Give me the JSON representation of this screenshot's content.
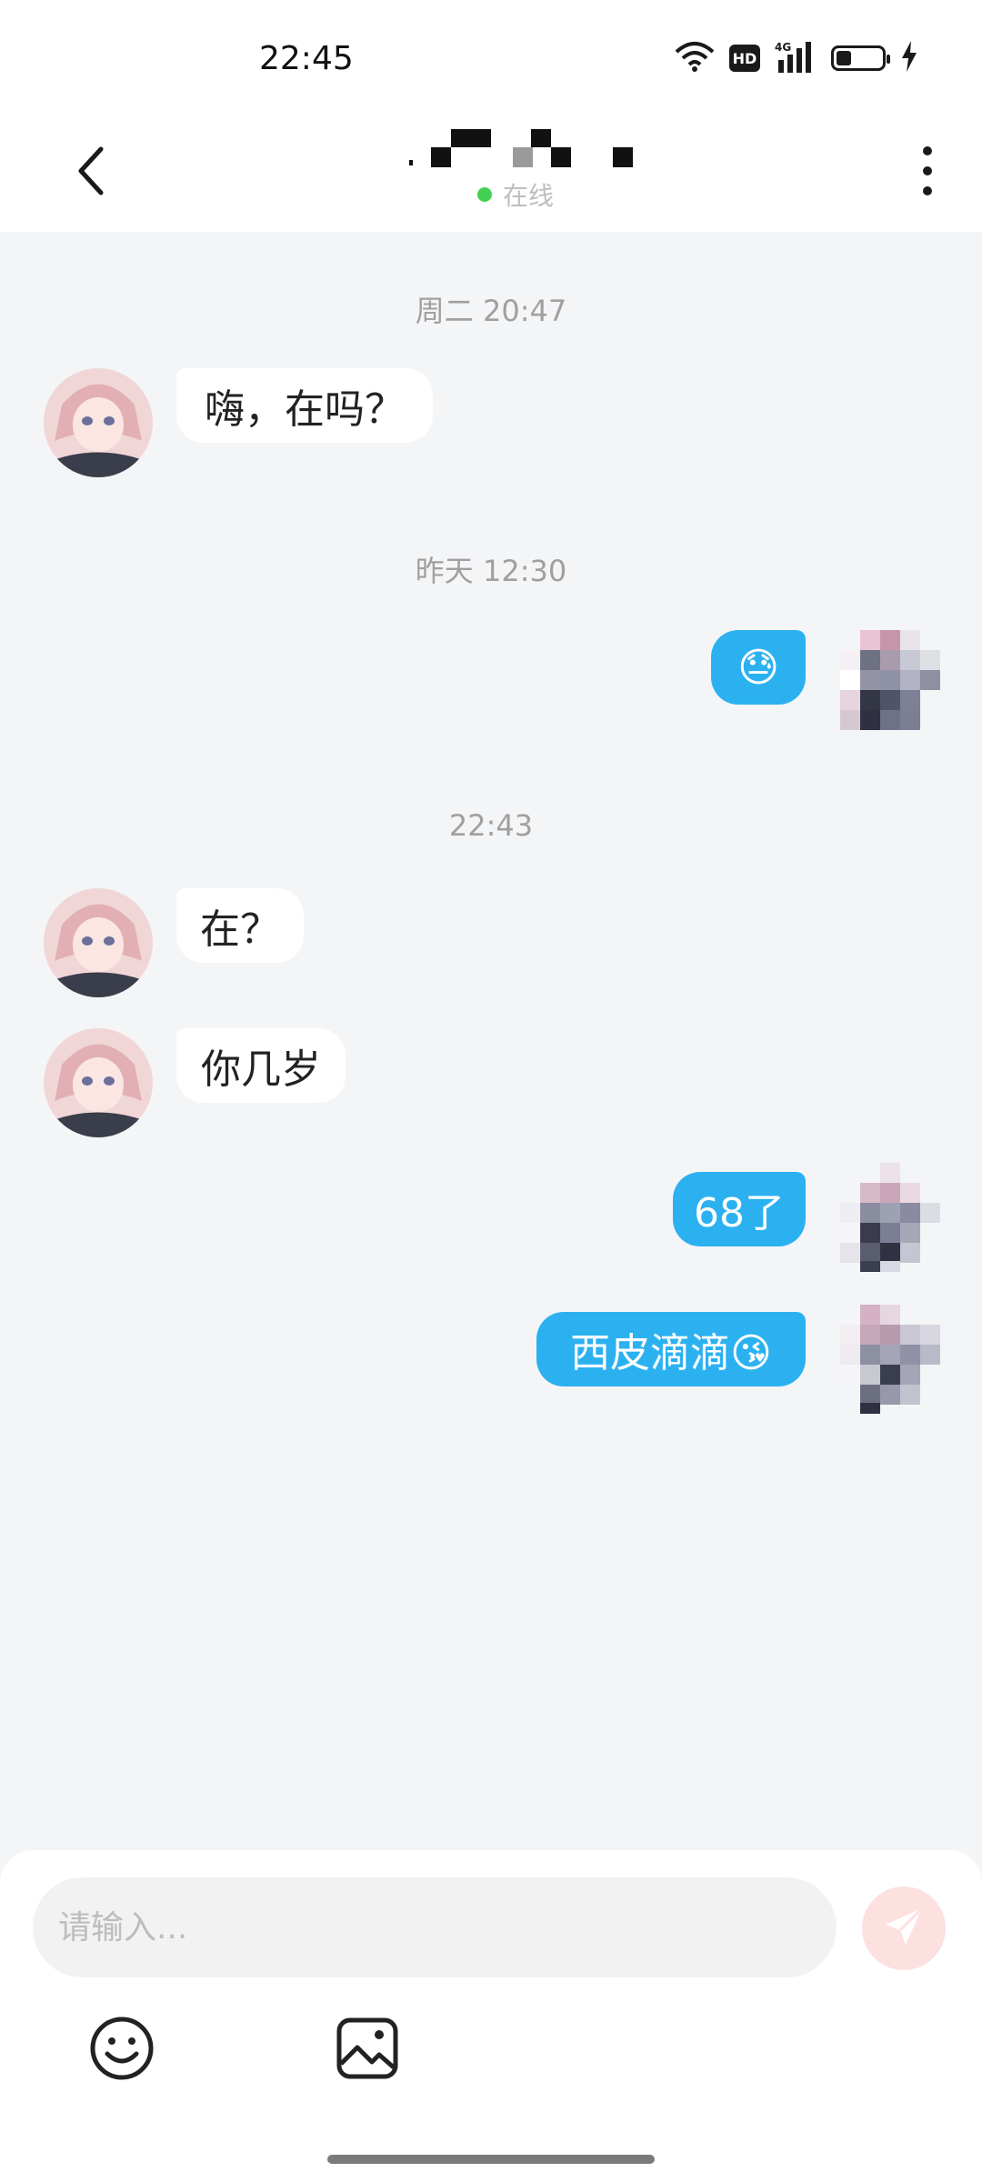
{
  "status_bar": {
    "time": "22:45",
    "icons": [
      "wifi-icon",
      "hd-icon",
      "signal-4g-icon",
      "battery-icon",
      "charging-icon"
    ],
    "hd_label": "HD",
    "network_label": "4G"
  },
  "header": {
    "online_label": "在线",
    "online_color": "#2ecc40"
  },
  "messages": [
    {
      "type": "timestamp",
      "text": "周二 20:47"
    },
    {
      "type": "incoming",
      "text": "嗨，在吗？"
    },
    {
      "type": "timestamp",
      "text": "昨天 12:30"
    },
    {
      "type": "outgoing",
      "text": "😓"
    },
    {
      "type": "timestamp",
      "text": "22:43"
    },
    {
      "type": "incoming",
      "text": "在？"
    },
    {
      "type": "incoming",
      "text": "你几岁"
    },
    {
      "type": "outgoing",
      "text": "68了"
    },
    {
      "type": "outgoing",
      "text": "西皮滴滴😘"
    }
  ],
  "input": {
    "placeholder": "请输入..."
  },
  "toolbar": {
    "emoji_icon": "smile-icon",
    "image_icon": "image-icon"
  },
  "colors": {
    "outgoing_bubble": "#2cb1f0",
    "incoming_bubble": "#ffffff",
    "chat_background": "#f4f5f7",
    "send_button": "#fde0e0"
  }
}
